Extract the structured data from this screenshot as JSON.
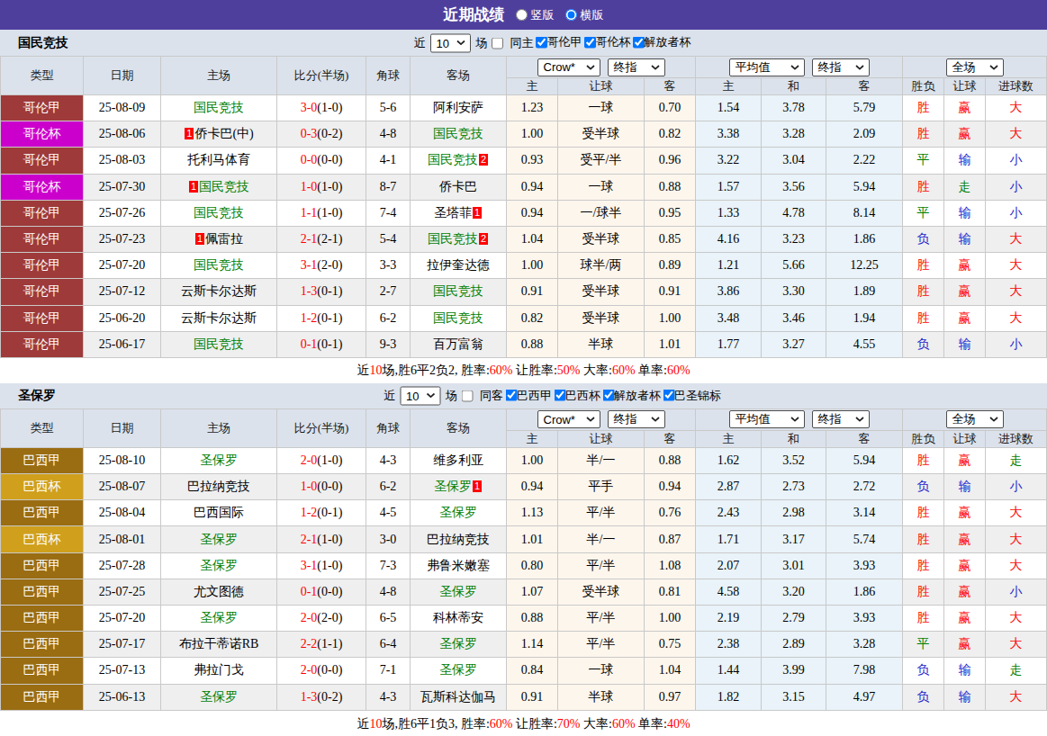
{
  "titlebar": {
    "title": "近期战绩",
    "radios": [
      {
        "label": "竖版",
        "checked": false
      },
      {
        "label": "横版",
        "checked": true
      }
    ]
  },
  "table": {
    "main_columns": [
      "类型",
      "日期",
      "主场",
      "比分(半场)",
      "角球",
      "客场"
    ],
    "sub_columns": [
      "主",
      "让球",
      "客",
      "主",
      "和",
      "客",
      "胜负",
      "让球",
      "进球数"
    ],
    "selects": {
      "crow": "Crow*",
      "final1": "终指",
      "avg": "平均值",
      "final2": "终指",
      "scope": "全场"
    }
  },
  "colors": {
    "league": {
      "哥伦甲": "#9E3A3A",
      "哥伦杯": "#CC00CC",
      "巴西甲": "#9A6D12",
      "巴西杯": "#D0A01C"
    },
    "outcome": {
      "red": "#FE0000",
      "green": "#008000",
      "blue": "#2222CC"
    },
    "highlight_team": "#008000",
    "score": "#FE0000",
    "accent_purple": "#4F3F9D"
  },
  "sections": [
    {
      "team": "国民竞技",
      "controls": {
        "near_label": "近",
        "count": "10",
        "games_label": "场",
        "same_venue": {
          "label": "同主",
          "checked": false
        },
        "leagues": [
          {
            "label": "哥伦甲",
            "checked": true
          },
          {
            "label": "哥伦杯",
            "checked": true
          },
          {
            "label": "解放者杯",
            "checked": true
          }
        ]
      },
      "rows": [
        {
          "league": "哥伦甲",
          "date": "25-08-09",
          "home": {
            "name": "国民竞技",
            "highlight": true
          },
          "score": "3-0",
          "half": "(1-0)",
          "corner": "5-6",
          "away": {
            "name": "阿利安萨",
            "highlight": false
          },
          "handicap_odds": [
            "1.23",
            "一球",
            "0.70"
          ],
          "europe_odds": [
            "1.54",
            "3.78",
            "5.79"
          ],
          "outcome": [
            [
              "胜",
              "red"
            ],
            [
              "赢",
              "red"
            ],
            [
              "大",
              "red"
            ]
          ]
        },
        {
          "league": "哥伦杯",
          "date": "25-08-06",
          "home": {
            "name": "侨卡巴(中)",
            "highlight": false,
            "badge_before": "1"
          },
          "score": "0-3",
          "half": "(0-2)",
          "corner": "4-8",
          "away": {
            "name": "国民竞技",
            "highlight": true
          },
          "handicap_odds": [
            "1.00",
            "受半球",
            "0.82"
          ],
          "europe_odds": [
            "3.38",
            "3.28",
            "2.09"
          ],
          "outcome": [
            [
              "胜",
              "red"
            ],
            [
              "赢",
              "red"
            ],
            [
              "大",
              "red"
            ]
          ]
        },
        {
          "league": "哥伦甲",
          "date": "25-08-03",
          "home": {
            "name": "托利马体育",
            "highlight": false
          },
          "score": "0-0",
          "half": "(0-0)",
          "corner": "4-1",
          "away": {
            "name": "国民竞技",
            "highlight": true,
            "badge_after": "2"
          },
          "handicap_odds": [
            "0.93",
            "受平/半",
            "0.96"
          ],
          "europe_odds": [
            "3.22",
            "3.04",
            "2.22"
          ],
          "outcome": [
            [
              "平",
              "green"
            ],
            [
              "输",
              "blue"
            ],
            [
              "小",
              "blue"
            ]
          ]
        },
        {
          "league": "哥伦杯",
          "date": "25-07-30",
          "home": {
            "name": "国民竞技",
            "highlight": true,
            "badge_before": "1"
          },
          "score": "1-0",
          "half": "(1-0)",
          "corner": "8-7",
          "away": {
            "name": "侨卡巴",
            "highlight": false
          },
          "handicap_odds": [
            "0.94",
            "一球",
            "0.88"
          ],
          "europe_odds": [
            "1.57",
            "3.56",
            "5.94"
          ],
          "outcome": [
            [
              "胜",
              "red"
            ],
            [
              "走",
              "green"
            ],
            [
              "小",
              "blue"
            ]
          ]
        },
        {
          "league": "哥伦甲",
          "date": "25-07-26",
          "home": {
            "name": "国民竞技",
            "highlight": true
          },
          "score": "1-1",
          "half": "(1-0)",
          "corner": "7-4",
          "away": {
            "name": "圣塔菲",
            "highlight": false,
            "badge_after": "1"
          },
          "handicap_odds": [
            "0.94",
            "一/球半",
            "0.95"
          ],
          "europe_odds": [
            "1.33",
            "4.78",
            "8.14"
          ],
          "outcome": [
            [
              "平",
              "green"
            ],
            [
              "输",
              "blue"
            ],
            [
              "小",
              "blue"
            ]
          ]
        },
        {
          "league": "哥伦甲",
          "date": "25-07-23",
          "home": {
            "name": "佩雷拉",
            "highlight": false,
            "badge_before": "1"
          },
          "score": "2-1",
          "half": "(2-1)",
          "corner": "5-4",
          "away": {
            "name": "国民竞技",
            "highlight": true,
            "badge_after": "2"
          },
          "handicap_odds": [
            "1.04",
            "受半球",
            "0.85"
          ],
          "europe_odds": [
            "4.16",
            "3.23",
            "1.86"
          ],
          "outcome": [
            [
              "负",
              "blue"
            ],
            [
              "输",
              "blue"
            ],
            [
              "大",
              "red"
            ]
          ]
        },
        {
          "league": "哥伦甲",
          "date": "25-07-20",
          "home": {
            "name": "国民竞技",
            "highlight": true
          },
          "score": "3-1",
          "half": "(2-0)",
          "corner": "3-3",
          "away": {
            "name": "拉伊奎达德",
            "highlight": false
          },
          "handicap_odds": [
            "1.00",
            "球半/两",
            "0.89"
          ],
          "europe_odds": [
            "1.21",
            "5.66",
            "12.25"
          ],
          "outcome": [
            [
              "胜",
              "red"
            ],
            [
              "赢",
              "red"
            ],
            [
              "大",
              "red"
            ]
          ]
        },
        {
          "league": "哥伦甲",
          "date": "25-07-12",
          "home": {
            "name": "云斯卡尔达斯",
            "highlight": false
          },
          "score": "1-3",
          "half": "(0-1)",
          "corner": "2-7",
          "away": {
            "name": "国民竞技",
            "highlight": true
          },
          "handicap_odds": [
            "0.91",
            "受半球",
            "0.91"
          ],
          "europe_odds": [
            "3.86",
            "3.30",
            "1.89"
          ],
          "outcome": [
            [
              "胜",
              "red"
            ],
            [
              "赢",
              "red"
            ],
            [
              "大",
              "red"
            ]
          ]
        },
        {
          "league": "哥伦甲",
          "date": "25-06-20",
          "home": {
            "name": "云斯卡尔达斯",
            "highlight": false
          },
          "score": "1-2",
          "half": "(0-1)",
          "corner": "6-2",
          "away": {
            "name": "国民竞技",
            "highlight": true
          },
          "handicap_odds": [
            "0.82",
            "受半球",
            "1.00"
          ],
          "europe_odds": [
            "3.48",
            "3.46",
            "1.94"
          ],
          "outcome": [
            [
              "胜",
              "red"
            ],
            [
              "赢",
              "red"
            ],
            [
              "大",
              "red"
            ]
          ]
        },
        {
          "league": "哥伦甲",
          "date": "25-06-17",
          "home": {
            "name": "国民竞技",
            "highlight": true
          },
          "score": "0-1",
          "half": "(0-1)",
          "corner": "9-3",
          "away": {
            "name": "百万富翁",
            "highlight": false
          },
          "handicap_odds": [
            "0.88",
            "半球",
            "1.01"
          ],
          "europe_odds": [
            "1.77",
            "3.27",
            "4.55"
          ],
          "outcome": [
            [
              "负",
              "blue"
            ],
            [
              "输",
              "blue"
            ],
            [
              "小",
              "blue"
            ]
          ]
        }
      ],
      "summary": [
        {
          "text": "近",
          "red": false
        },
        {
          "text": "10",
          "red": true
        },
        {
          "text": "场,胜6平2负2, 胜率:",
          "red": false
        },
        {
          "text": "60%",
          "red": true
        },
        {
          "text": " 让胜率:",
          "red": false
        },
        {
          "text": "50%",
          "red": true
        },
        {
          "text": " 大率:",
          "red": false
        },
        {
          "text": "60%",
          "red": true
        },
        {
          "text": " 单率:",
          "red": false
        },
        {
          "text": "60%",
          "red": true
        }
      ]
    },
    {
      "team": "圣保罗",
      "controls": {
        "near_label": "近",
        "count": "10",
        "games_label": "场",
        "same_venue": {
          "label": "同客",
          "checked": false
        },
        "leagues": [
          {
            "label": "巴西甲",
            "checked": true
          },
          {
            "label": "巴西杯",
            "checked": true
          },
          {
            "label": "解放者杯",
            "checked": true
          },
          {
            "label": "巴圣锦标",
            "checked": true
          }
        ]
      },
      "rows": [
        {
          "league": "巴西甲",
          "date": "25-08-10",
          "home": {
            "name": "圣保罗",
            "highlight": true
          },
          "score": "2-0",
          "half": "(1-0)",
          "corner": "4-3",
          "away": {
            "name": "维多利亚",
            "highlight": false
          },
          "handicap_odds": [
            "1.00",
            "半/一",
            "0.88"
          ],
          "europe_odds": [
            "1.62",
            "3.52",
            "5.94"
          ],
          "outcome": [
            [
              "胜",
              "red"
            ],
            [
              "赢",
              "red"
            ],
            [
              "走",
              "green"
            ]
          ]
        },
        {
          "league": "巴西杯",
          "date": "25-08-07",
          "home": {
            "name": "巴拉纳竞技",
            "highlight": false
          },
          "score": "1-0",
          "half": "(0-0)",
          "corner": "6-2",
          "away": {
            "name": "圣保罗",
            "highlight": true,
            "badge_after": "1"
          },
          "handicap_odds": [
            "0.94",
            "平手",
            "0.94"
          ],
          "europe_odds": [
            "2.87",
            "2.73",
            "2.72"
          ],
          "outcome": [
            [
              "负",
              "blue"
            ],
            [
              "输",
              "blue"
            ],
            [
              "小",
              "blue"
            ]
          ]
        },
        {
          "league": "巴西甲",
          "date": "25-08-04",
          "home": {
            "name": "巴西国际",
            "highlight": false
          },
          "score": "1-2",
          "half": "(0-1)",
          "corner": "4-5",
          "away": {
            "name": "圣保罗",
            "highlight": true
          },
          "handicap_odds": [
            "1.13",
            "平/半",
            "0.76"
          ],
          "europe_odds": [
            "2.43",
            "2.98",
            "3.14"
          ],
          "outcome": [
            [
              "胜",
              "red"
            ],
            [
              "赢",
              "red"
            ],
            [
              "大",
              "red"
            ]
          ]
        },
        {
          "league": "巴西杯",
          "date": "25-08-01",
          "home": {
            "name": "圣保罗",
            "highlight": true
          },
          "score": "2-1",
          "half": "(1-0)",
          "corner": "3-0",
          "away": {
            "name": "巴拉纳竞技",
            "highlight": false
          },
          "handicap_odds": [
            "1.01",
            "半/一",
            "0.87"
          ],
          "europe_odds": [
            "1.71",
            "3.17",
            "5.74"
          ],
          "outcome": [
            [
              "胜",
              "red"
            ],
            [
              "赢",
              "red"
            ],
            [
              "大",
              "red"
            ]
          ]
        },
        {
          "league": "巴西甲",
          "date": "25-07-28",
          "home": {
            "name": "圣保罗",
            "highlight": true
          },
          "score": "3-1",
          "half": "(1-0)",
          "corner": "7-3",
          "away": {
            "name": "弗鲁米嫩塞",
            "highlight": false
          },
          "handicap_odds": [
            "0.80",
            "平/半",
            "1.08"
          ],
          "europe_odds": [
            "2.07",
            "3.01",
            "3.93"
          ],
          "outcome": [
            [
              "胜",
              "red"
            ],
            [
              "赢",
              "red"
            ],
            [
              "大",
              "red"
            ]
          ]
        },
        {
          "league": "巴西甲",
          "date": "25-07-25",
          "home": {
            "name": "尤文图德",
            "highlight": false
          },
          "score": "0-1",
          "half": "(0-0)",
          "corner": "4-8",
          "away": {
            "name": "圣保罗",
            "highlight": true
          },
          "handicap_odds": [
            "1.07",
            "受半球",
            "0.81"
          ],
          "europe_odds": [
            "4.58",
            "3.20",
            "1.86"
          ],
          "outcome": [
            [
              "胜",
              "red"
            ],
            [
              "赢",
              "red"
            ],
            [
              "小",
              "blue"
            ]
          ]
        },
        {
          "league": "巴西甲",
          "date": "25-07-20",
          "home": {
            "name": "圣保罗",
            "highlight": true
          },
          "score": "2-0",
          "half": "(2-0)",
          "corner": "6-5",
          "away": {
            "name": "科林蒂安",
            "highlight": false
          },
          "handicap_odds": [
            "0.88",
            "平/半",
            "1.00"
          ],
          "europe_odds": [
            "2.19",
            "2.79",
            "3.93"
          ],
          "outcome": [
            [
              "胜",
              "red"
            ],
            [
              "赢",
              "red"
            ],
            [
              "大",
              "red"
            ]
          ]
        },
        {
          "league": "巴西甲",
          "date": "25-07-17",
          "home": {
            "name": "布拉干蒂诺RB",
            "highlight": false
          },
          "score": "2-2",
          "half": "(1-1)",
          "corner": "6-4",
          "away": {
            "name": "圣保罗",
            "highlight": true
          },
          "handicap_odds": [
            "1.14",
            "平/半",
            "0.75"
          ],
          "europe_odds": [
            "2.38",
            "2.89",
            "3.28"
          ],
          "outcome": [
            [
              "平",
              "green"
            ],
            [
              "赢",
              "red"
            ],
            [
              "大",
              "red"
            ]
          ]
        },
        {
          "league": "巴西甲",
          "date": "25-07-13",
          "home": {
            "name": "弗拉门戈",
            "highlight": false
          },
          "score": "2-0",
          "half": "(0-0)",
          "corner": "7-1",
          "away": {
            "name": "圣保罗",
            "highlight": true
          },
          "handicap_odds": [
            "0.84",
            "一球",
            "1.04"
          ],
          "europe_odds": [
            "1.44",
            "3.99",
            "7.98"
          ],
          "outcome": [
            [
              "负",
              "blue"
            ],
            [
              "输",
              "blue"
            ],
            [
              "走",
              "green"
            ]
          ]
        },
        {
          "league": "巴西甲",
          "date": "25-06-13",
          "home": {
            "name": "圣保罗",
            "highlight": true
          },
          "score": "1-3",
          "half": "(0-2)",
          "corner": "4-3",
          "away": {
            "name": "瓦斯科达伽马",
            "highlight": false
          },
          "handicap_odds": [
            "0.91",
            "半球",
            "0.97"
          ],
          "europe_odds": [
            "1.82",
            "3.15",
            "4.97"
          ],
          "outcome": [
            [
              "负",
              "blue"
            ],
            [
              "输",
              "blue"
            ],
            [
              "大",
              "red"
            ]
          ]
        }
      ],
      "summary": [
        {
          "text": "近",
          "red": false
        },
        {
          "text": "10",
          "red": true
        },
        {
          "text": "场,胜6平1负3, 胜率:",
          "red": false
        },
        {
          "text": "60%",
          "red": true
        },
        {
          "text": " 让胜率:",
          "red": false
        },
        {
          "text": "70%",
          "red": true
        },
        {
          "text": " 大率:",
          "red": false
        },
        {
          "text": "60%",
          "red": true
        },
        {
          "text": " 单率:",
          "red": false
        },
        {
          "text": "40%",
          "red": true
        }
      ]
    }
  ]
}
